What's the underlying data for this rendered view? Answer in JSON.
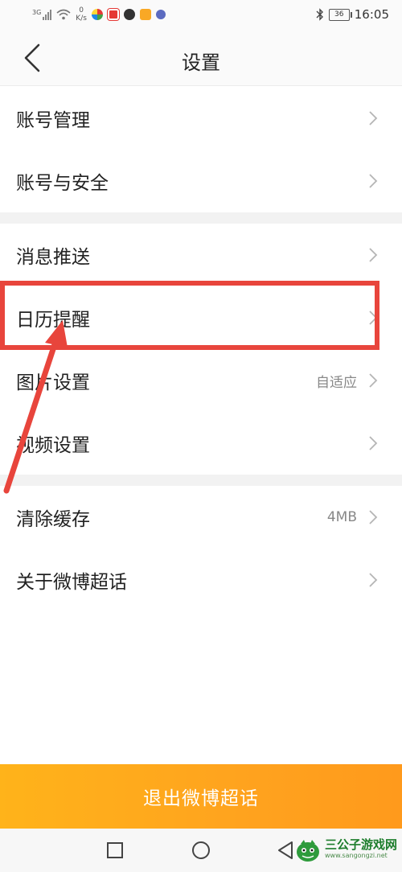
{
  "status_bar": {
    "network_type": "3G",
    "speed_value": "0",
    "speed_unit": "K/s",
    "battery": "36",
    "time": "16:05"
  },
  "header": {
    "title": "设置"
  },
  "settings": {
    "group1": [
      {
        "label": "账号管理",
        "value": ""
      },
      {
        "label": "账号与安全",
        "value": ""
      }
    ],
    "group2": [
      {
        "label": "消息推送",
        "value": ""
      },
      {
        "label": "日历提醒",
        "value": ""
      },
      {
        "label": "图片设置",
        "value": "自适应"
      },
      {
        "label": "视频设置",
        "value": ""
      }
    ],
    "group3": [
      {
        "label": "清除缓存",
        "value": "4MB"
      },
      {
        "label": "关于微博超话",
        "value": ""
      }
    ]
  },
  "logout": {
    "label": "退出微博超话"
  },
  "colors": {
    "accent": "#ffa31e",
    "annotation": "#e8453c"
  },
  "watermark": {
    "name": "三公子游戏网",
    "url": "www.sangongzi.net"
  }
}
